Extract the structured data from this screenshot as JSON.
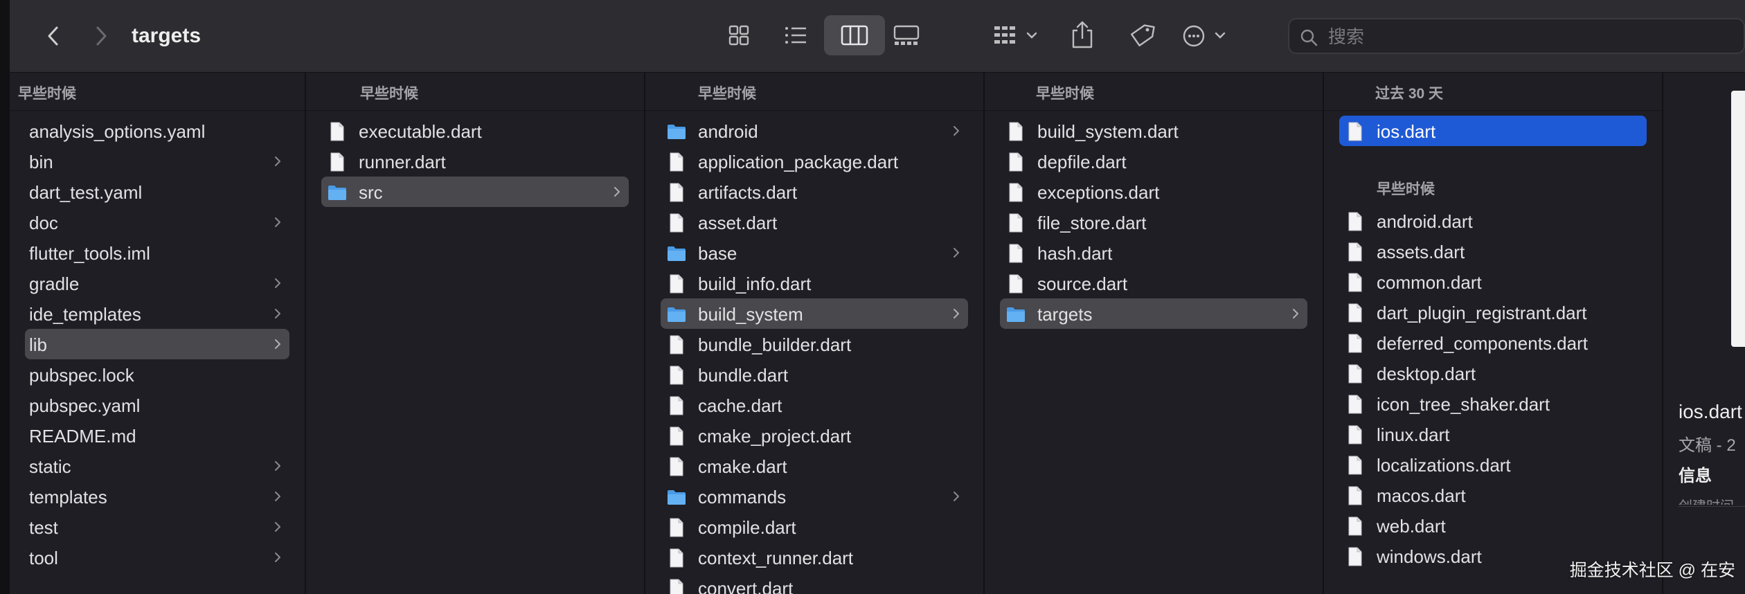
{
  "toolbar": {
    "title": "targets",
    "search": {
      "placeholder": "搜索",
      "value": ""
    }
  },
  "columns": [
    {
      "header": "早些时候",
      "items": [
        {
          "label": "analysis_options.yaml",
          "type": "file",
          "chevron": false,
          "selected": ""
        },
        {
          "label": "bin",
          "type": "folder-plain",
          "chevron": true,
          "selected": ""
        },
        {
          "label": "dart_test.yaml",
          "type": "file",
          "chevron": false,
          "selected": ""
        },
        {
          "label": "doc",
          "type": "folder-plain",
          "chevron": true,
          "selected": ""
        },
        {
          "label": "flutter_tools.iml",
          "type": "file",
          "chevron": false,
          "selected": ""
        },
        {
          "label": "gradle",
          "type": "folder-plain",
          "chevron": true,
          "selected": ""
        },
        {
          "label": "ide_templates",
          "type": "folder-plain",
          "chevron": true,
          "selected": ""
        },
        {
          "label": "lib",
          "type": "folder-plain",
          "chevron": true,
          "selected": "gray"
        },
        {
          "label": "pubspec.lock",
          "type": "file",
          "chevron": false,
          "selected": ""
        },
        {
          "label": "pubspec.yaml",
          "type": "file",
          "chevron": false,
          "selected": ""
        },
        {
          "label": "README.md",
          "type": "file",
          "chevron": false,
          "selected": ""
        },
        {
          "label": "static",
          "type": "folder-plain",
          "chevron": true,
          "selected": ""
        },
        {
          "label": "templates",
          "type": "folder-plain",
          "chevron": true,
          "selected": ""
        },
        {
          "label": "test",
          "type": "folder-plain",
          "chevron": true,
          "selected": ""
        },
        {
          "label": "tool",
          "type": "folder-plain",
          "chevron": true,
          "selected": ""
        }
      ]
    },
    {
      "header": "早些时候",
      "items": [
        {
          "label": "executable.dart",
          "type": "file",
          "chevron": false,
          "selected": ""
        },
        {
          "label": "runner.dart",
          "type": "file",
          "chevron": false,
          "selected": ""
        },
        {
          "label": "src",
          "type": "folder",
          "chevron": true,
          "selected": "gray"
        }
      ]
    },
    {
      "header": "早些时候",
      "items": [
        {
          "label": "android",
          "type": "folder",
          "chevron": true,
          "selected": ""
        },
        {
          "label": "application_package.dart",
          "type": "file",
          "chevron": false,
          "selected": ""
        },
        {
          "label": "artifacts.dart",
          "type": "file",
          "chevron": false,
          "selected": ""
        },
        {
          "label": "asset.dart",
          "type": "file",
          "chevron": false,
          "selected": ""
        },
        {
          "label": "base",
          "type": "folder",
          "chevron": true,
          "selected": ""
        },
        {
          "label": "build_info.dart",
          "type": "file",
          "chevron": false,
          "selected": ""
        },
        {
          "label": "build_system",
          "type": "folder",
          "chevron": true,
          "selected": "gray"
        },
        {
          "label": "bundle_builder.dart",
          "type": "file",
          "chevron": false,
          "selected": ""
        },
        {
          "label": "bundle.dart",
          "type": "file",
          "chevron": false,
          "selected": ""
        },
        {
          "label": "cache.dart",
          "type": "file",
          "chevron": false,
          "selected": ""
        },
        {
          "label": "cmake_project.dart",
          "type": "file",
          "chevron": false,
          "selected": ""
        },
        {
          "label": "cmake.dart",
          "type": "file",
          "chevron": false,
          "selected": ""
        },
        {
          "label": "commands",
          "type": "folder",
          "chevron": true,
          "selected": ""
        },
        {
          "label": "compile.dart",
          "type": "file",
          "chevron": false,
          "selected": ""
        },
        {
          "label": "context_runner.dart",
          "type": "file",
          "chevron": false,
          "selected": ""
        },
        {
          "label": "convert.dart",
          "type": "file",
          "chevron": false,
          "selected": ""
        }
      ]
    },
    {
      "header": "早些时候",
      "items": [
        {
          "label": "build_system.dart",
          "type": "file",
          "chevron": false,
          "selected": ""
        },
        {
          "label": "depfile.dart",
          "type": "file",
          "chevron": false,
          "selected": ""
        },
        {
          "label": "exceptions.dart",
          "type": "file",
          "chevron": false,
          "selected": ""
        },
        {
          "label": "file_store.dart",
          "type": "file",
          "chevron": false,
          "selected": ""
        },
        {
          "label": "hash.dart",
          "type": "file",
          "chevron": false,
          "selected": ""
        },
        {
          "label": "source.dart",
          "type": "file",
          "chevron": false,
          "selected": ""
        },
        {
          "label": "targets",
          "type": "folder",
          "chevron": true,
          "selected": "gray"
        }
      ]
    },
    {
      "header": "过去 30 天",
      "items": [
        {
          "label": "ios.dart",
          "type": "file",
          "chevron": false,
          "selected": "blue"
        }
      ],
      "subheader": "早些时候",
      "items2": [
        {
          "label": "android.dart",
          "type": "file",
          "chevron": false,
          "selected": ""
        },
        {
          "label": "assets.dart",
          "type": "file",
          "chevron": false,
          "selected": ""
        },
        {
          "label": "common.dart",
          "type": "file",
          "chevron": false,
          "selected": ""
        },
        {
          "label": "dart_plugin_registrant.dart",
          "type": "file",
          "chevron": false,
          "selected": ""
        },
        {
          "label": "deferred_components.dart",
          "type": "file",
          "chevron": false,
          "selected": ""
        },
        {
          "label": "desktop.dart",
          "type": "file",
          "chevron": false,
          "selected": ""
        },
        {
          "label": "icon_tree_shaker.dart",
          "type": "file",
          "chevron": false,
          "selected": ""
        },
        {
          "label": "linux.dart",
          "type": "file",
          "chevron": false,
          "selected": ""
        },
        {
          "label": "localizations.dart",
          "type": "file",
          "chevron": false,
          "selected": ""
        },
        {
          "label": "macos.dart",
          "type": "file",
          "chevron": false,
          "selected": ""
        },
        {
          "label": "web.dart",
          "type": "file",
          "chevron": false,
          "selected": ""
        },
        {
          "label": "windows.dart",
          "type": "file",
          "chevron": false,
          "selected": ""
        }
      ]
    }
  ],
  "preview": {
    "name": "ios.dart",
    "kind": "文稿 - 2",
    "info_title": "信息",
    "created_label": "创建时间"
  },
  "watermark": "掘金技术社区 @ 在安",
  "colors": {
    "selection_blue": "#1f5ad6",
    "selection_gray": "#48484d",
    "folder_blue": "#5aa9f0",
    "background": "#1e1e24",
    "toolbar": "#2d2d31"
  }
}
